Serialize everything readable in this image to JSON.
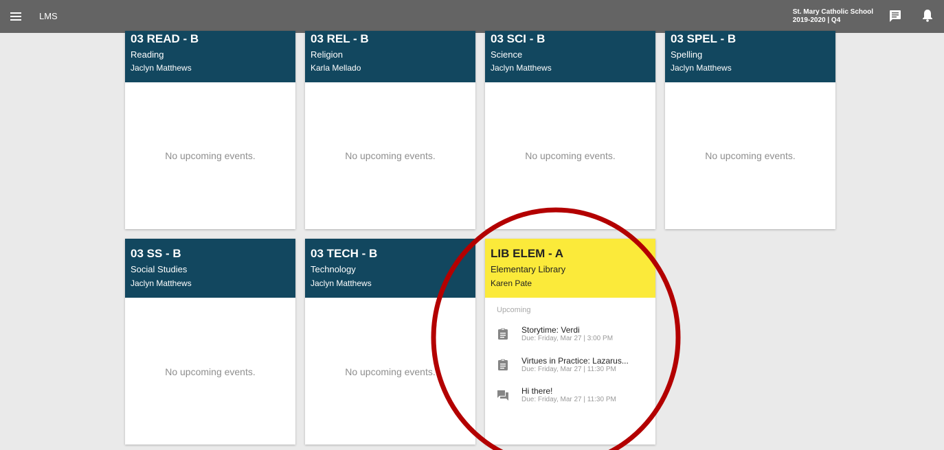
{
  "app": {
    "name": "LMS",
    "school_name": "St. Mary Catholic School",
    "term": "2019-2020 | Q4",
    "menu_icon": "menu-icon",
    "chat_icon": "chat-icon",
    "bell_icon": "bell-icon"
  },
  "empty_text": "No upcoming events.",
  "courses": [
    {
      "code": "03 READ - B",
      "name": "Reading",
      "teacher": "Jaclyn Matthews"
    },
    {
      "code": "03 REL - B",
      "name": "Religion",
      "teacher": "Karla Mellado"
    },
    {
      "code": "03 SCI - B",
      "name": "Science",
      "teacher": "Jaclyn Matthews"
    },
    {
      "code": "03 SPEL - B",
      "name": "Spelling",
      "teacher": "Jaclyn Matthews"
    },
    {
      "code": "03 SS - B",
      "name": "Social Studies",
      "teacher": "Jaclyn Matthews"
    },
    {
      "code": "03 TECH - B",
      "name": "Technology",
      "teacher": "Jaclyn Matthews"
    },
    {
      "code": "LIB ELEM - A",
      "name": "Elementary Library",
      "teacher": "Karen Pate",
      "upcoming_label": "Upcoming",
      "events": [
        {
          "title": "Storytime: Verdi",
          "due": "Due: Friday, Mar 27 | 3:00 PM",
          "icon": "assignment-icon"
        },
        {
          "title": "Virtues in Practice: Lazarus...",
          "due": "Due: Friday, Mar 27 | 11:30 PM",
          "icon": "assignment-icon"
        },
        {
          "title": "Hi there!",
          "due": "Due: Friday, Mar 27 | 11:30 PM",
          "icon": "discussion-icon"
        }
      ]
    }
  ],
  "colors": {
    "appbar": "#646464",
    "card_header": "#12475f",
    "highlight_header": "#fbea3a",
    "annotation_circle": "#b30000"
  }
}
